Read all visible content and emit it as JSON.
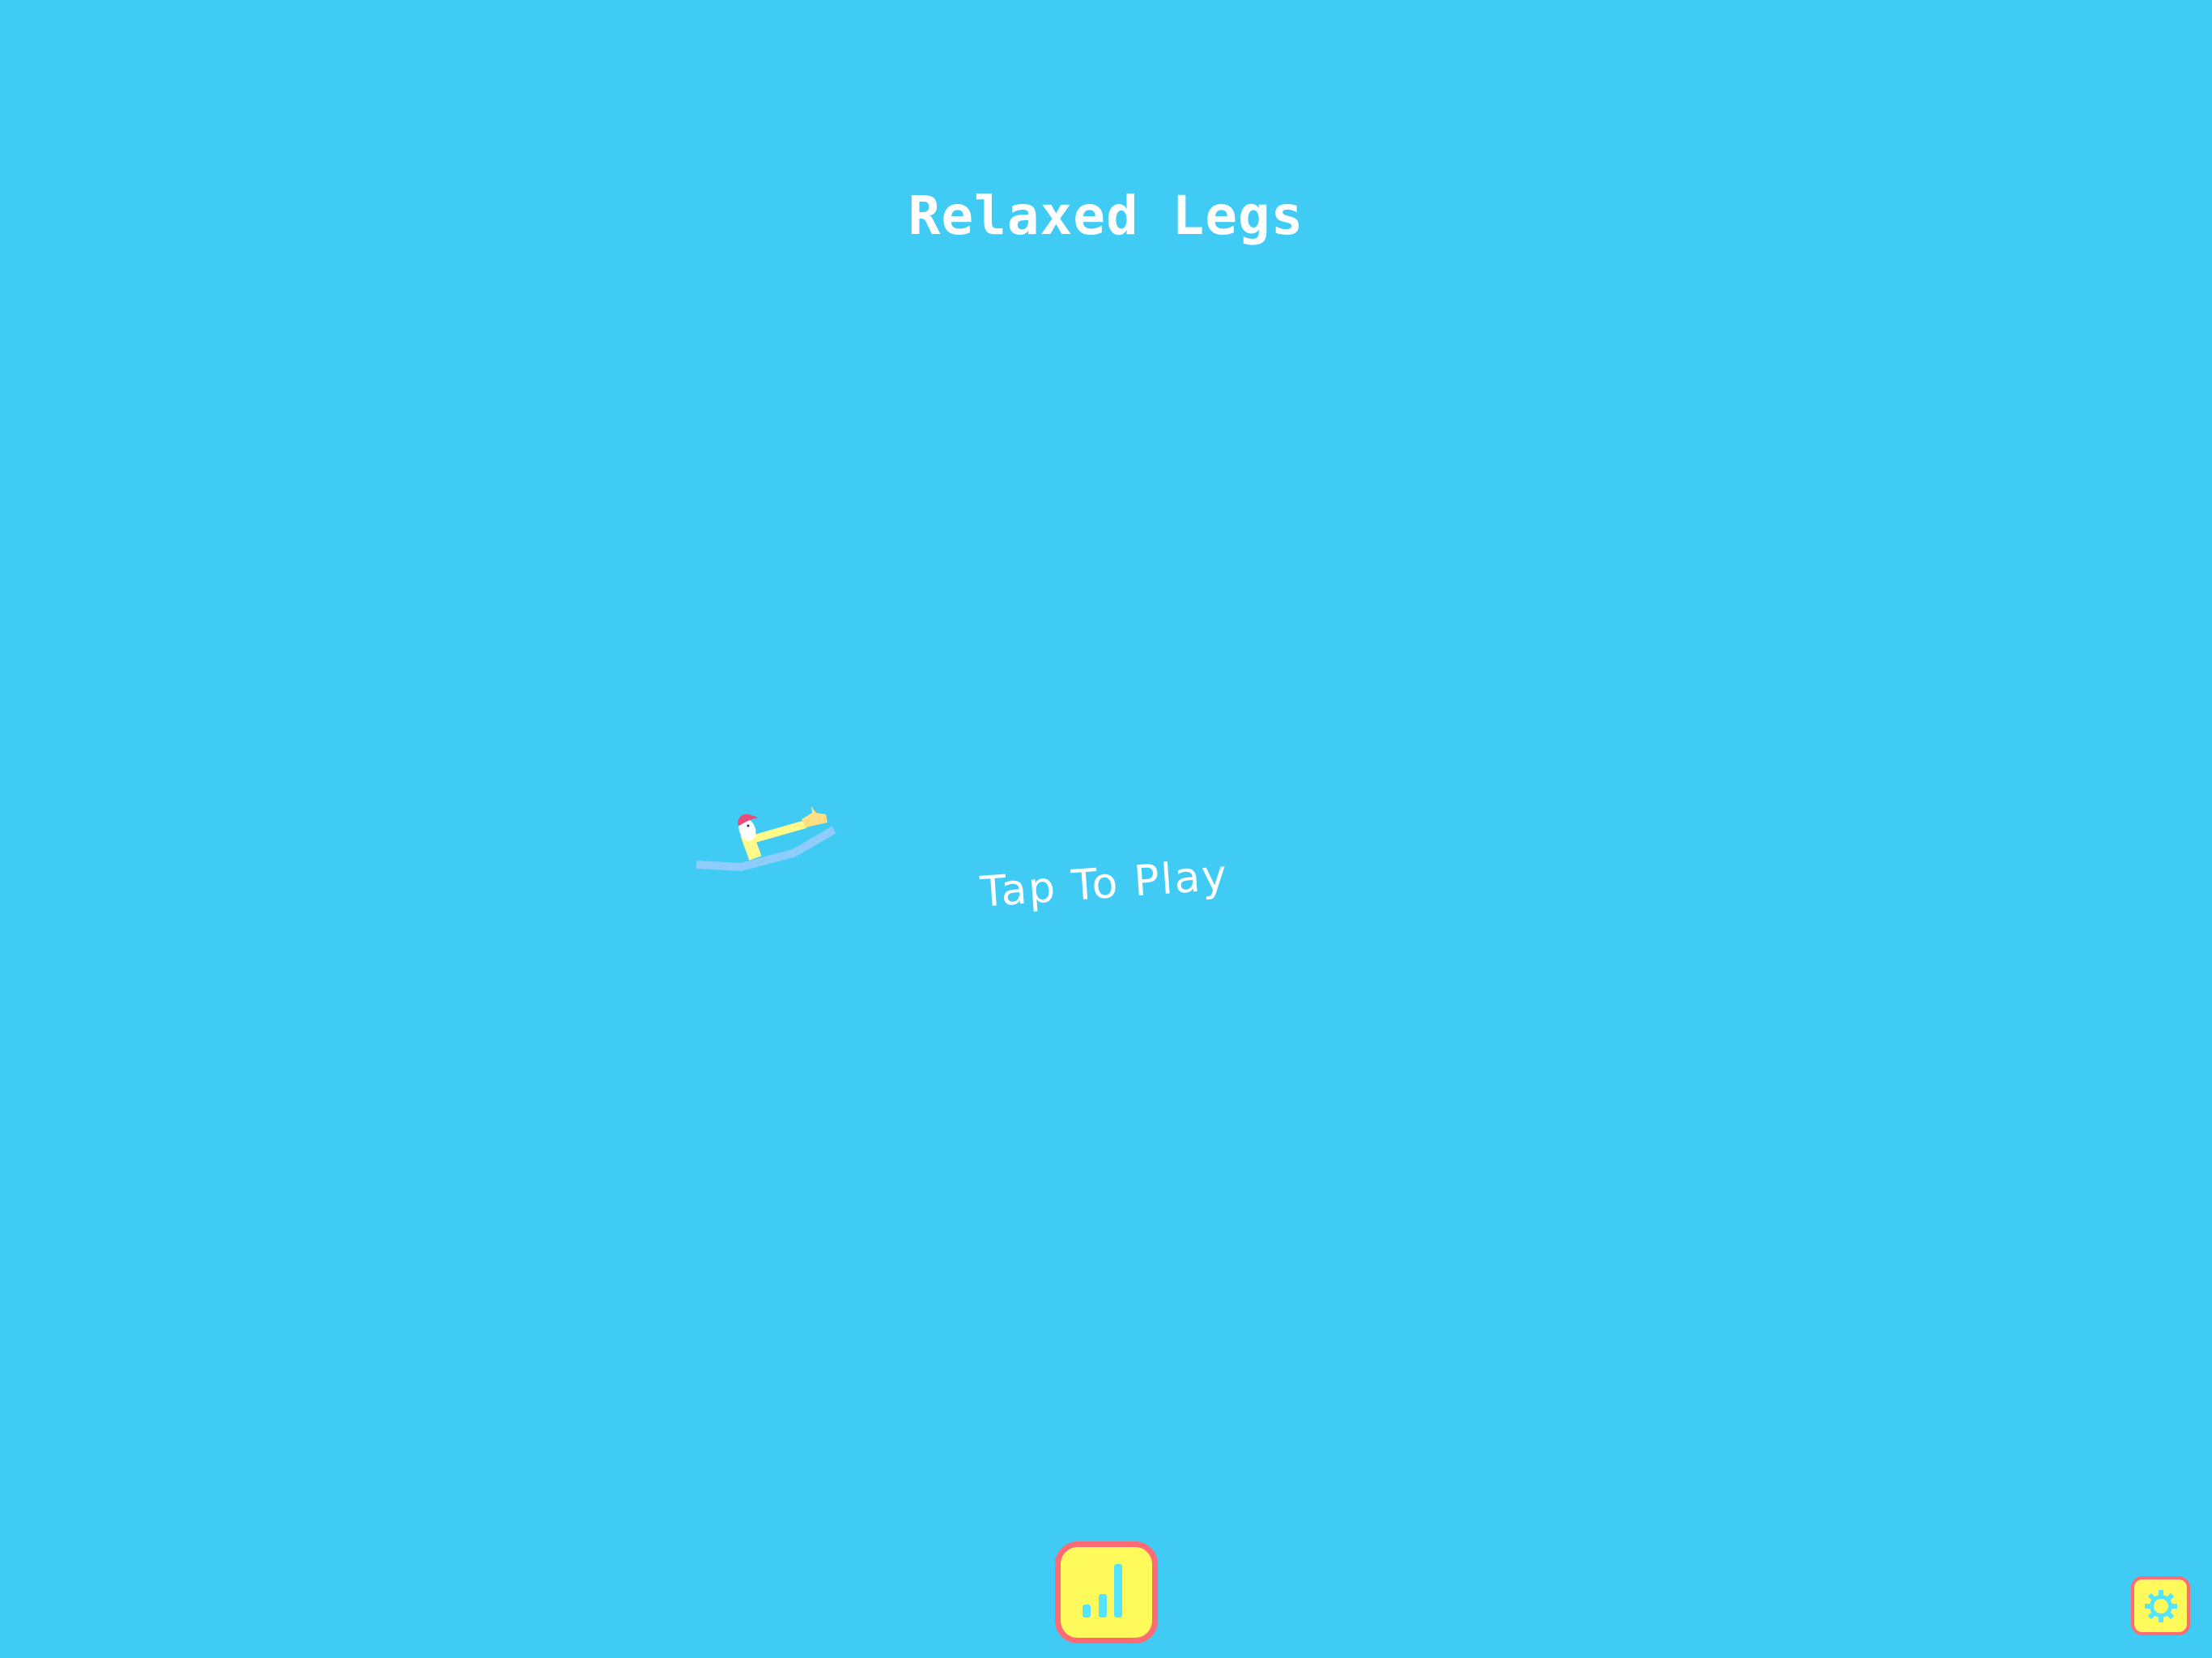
{
  "title": "Relaxed Legs",
  "prompt": "Tap To Play",
  "buttons": {
    "leaderboard_icon": "bar-chart-icon",
    "settings_icon": "gear-icon"
  },
  "colors": {
    "background": "#40cbf4",
    "button_fill": "#fffa5c",
    "button_border": "#ff6b75",
    "icon": "#55e4ff"
  }
}
